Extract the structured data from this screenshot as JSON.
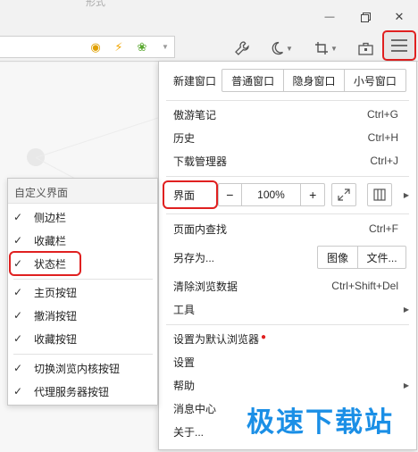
{
  "titlebar": {
    "faint_tab": "形式",
    "minimize": "—",
    "maximize": "❐",
    "close": "✕"
  },
  "toolbar": {
    "icons": [
      "bee-icon",
      "lightning-icon",
      "leaf-icon",
      "dropdown-icon",
      "tools-icon",
      "night-mode-icon",
      "crop-icon",
      "toolbox-icon",
      "menu-icon"
    ]
  },
  "main_menu": {
    "new_window": "新建窗口",
    "window_buttons": [
      "普通窗口",
      "隐身窗口",
      "小号窗口"
    ],
    "items_group1": [
      {
        "label": "傲游笔记",
        "shortcut": "Ctrl+G"
      },
      {
        "label": "历史",
        "shortcut": "Ctrl+H"
      },
      {
        "label": "下载管理器",
        "shortcut": "Ctrl+J"
      }
    ],
    "interface": "界面",
    "zoom": {
      "minus": "−",
      "value": "100%",
      "plus": "+"
    },
    "find": {
      "label": "页面内查找",
      "shortcut": "Ctrl+F"
    },
    "save_as": "另存为...",
    "save_buttons": [
      "图像",
      "文件..."
    ],
    "clear": {
      "label": "清除浏览数据",
      "shortcut": "Ctrl+Shift+Del"
    },
    "tools": "工具",
    "set_default": "设置为默认浏览器",
    "settings": "设置",
    "help": "帮助",
    "messages": "消息中心",
    "about": "关于..."
  },
  "sub_menu": {
    "header": "自定义界面",
    "group1": [
      "侧边栏",
      "收藏栏",
      "状态栏"
    ],
    "group2": [
      "主页按钮",
      "撤消按钮",
      "收藏按钮"
    ],
    "group3": [
      "切换浏览内核按钮",
      "代理服务器按钮"
    ],
    "check": "✓"
  },
  "watermark": "极速下载站",
  "colors": {
    "highlight_red": "#e02020",
    "watermark_blue": "#1b8fe6"
  }
}
